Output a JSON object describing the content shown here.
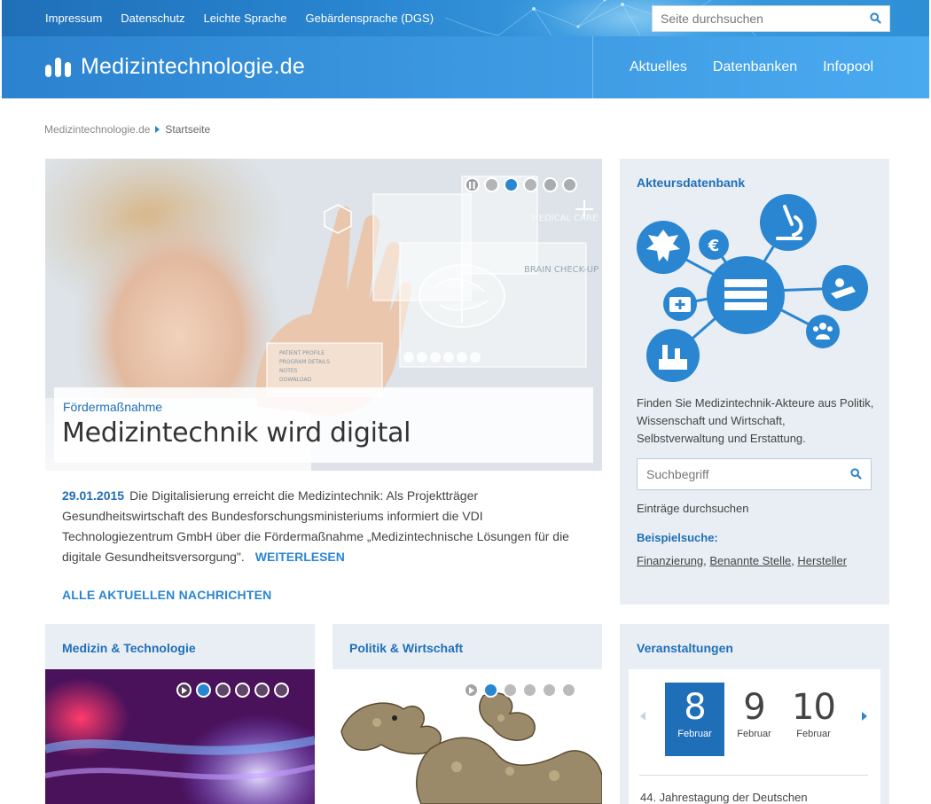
{
  "topbar": {
    "links": [
      "Impressum",
      "Datenschutz",
      "Leichte Sprache",
      "Gebärdensprache (DGS)"
    ],
    "search_placeholder": "Seite durchsuchen"
  },
  "header": {
    "logo_text": "Medizintechnologie.de",
    "nav": [
      "Aktuelles",
      "Datenbanken",
      "Infopool"
    ]
  },
  "breadcrumb": {
    "home": "Medizintechnologie.de",
    "current": "Startseite"
  },
  "hero": {
    "kicker": "Fördermaßnahme",
    "title": "Medizintechnik wird digital",
    "slides_total": 5,
    "active_slide": 2,
    "overlay_labels": [
      "MEDICAL CARE",
      "BRAIN CHECK-UP",
      "PATIENT PROFILE",
      "PROGRAM DETAILS",
      "NOTES",
      "DOWNLOAD"
    ]
  },
  "article": {
    "date": "29.01.2015",
    "text": "Die Digitalisierung erreicht die Medizintechnik: Als Projektträger Gesundheitswirtschaft des Bundesforschungsministeriums informiert die VDI Technologiezentrum GmbH über die Fördermaßnahme „Medizintechnische Lösungen für die digitale Gesundheitsversorgung\".",
    "more": "WEITERLESEN",
    "all_news": "ALLE AKTUELLEN NACHRICHTEN"
  },
  "akteur": {
    "title": "Akteursdatenbank",
    "description": "Finden Sie Medizintechnik-Akteure aus Politik, Wissenschaft und Wirtschaft, Selbstverwaltung und Erstattung.",
    "search_placeholder": "Suchbegriff",
    "browse": "Einträge durchsuchen",
    "example_label": "Beispielsuche:",
    "examples": [
      "Finanzierung",
      "Benannte Stelle",
      "Hersteller"
    ],
    "icons": [
      "eagle-icon",
      "euro-icon",
      "microscope-icon",
      "patient-icon",
      "medkit-icon",
      "database-icon",
      "group-icon",
      "factory-icon"
    ],
    "accent": "#2a86d1"
  },
  "cards": [
    {
      "title": "Medizin & Technologie",
      "slides_total": 5,
      "active_slide": 0
    },
    {
      "title": "Politik & Wirtschaft",
      "slides_total": 5,
      "active_slide": 0
    }
  ],
  "events": {
    "title": "Veranstaltungen",
    "days": [
      {
        "day": "8",
        "month": "Februar",
        "selected": true
      },
      {
        "day": "9",
        "month": "Februar",
        "selected": false
      },
      {
        "day": "10",
        "month": "Februar",
        "selected": false
      }
    ],
    "first_event": "44. Jahrestagung der Deutschen"
  },
  "colors": {
    "primary": "#1f6fb8",
    "accent": "#2a86d1",
    "panel": "#e8eef4"
  }
}
